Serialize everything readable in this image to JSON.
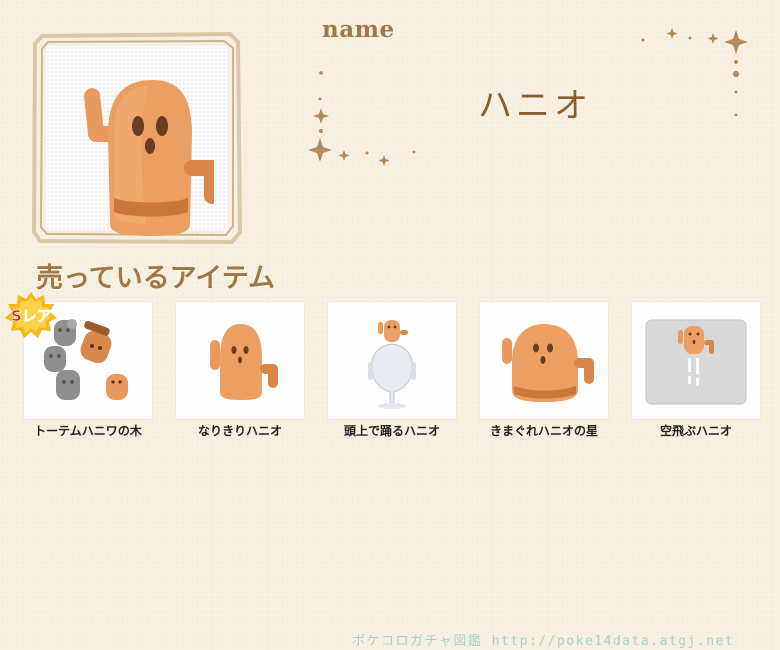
{
  "profile": {
    "name_label": "name",
    "name_value": "ハニオ"
  },
  "section": {
    "title": "売っているアイテム"
  },
  "items": [
    {
      "caption": "トーテムハニワの木",
      "badge": "Sレア",
      "icon": "totem-haniwa-tree-icon"
    },
    {
      "caption": "なりきりハニオ",
      "icon": "haniwa-costume-icon"
    },
    {
      "caption": "頭上で踊るハニオ",
      "icon": "dancing-haniwa-icon"
    },
    {
      "caption": "きまぐれハニオの星",
      "icon": "haniwa-star-icon"
    },
    {
      "caption": "空飛ぶハニオ",
      "icon": "flying-haniwa-icon"
    }
  ],
  "footer": {
    "text": "ポケコロガチャ図鑑 http://poke14data.atgj.net"
  },
  "colors": {
    "background": "#f7f0e1",
    "heading": "#a07848",
    "haniwa": "#e39a5c"
  }
}
